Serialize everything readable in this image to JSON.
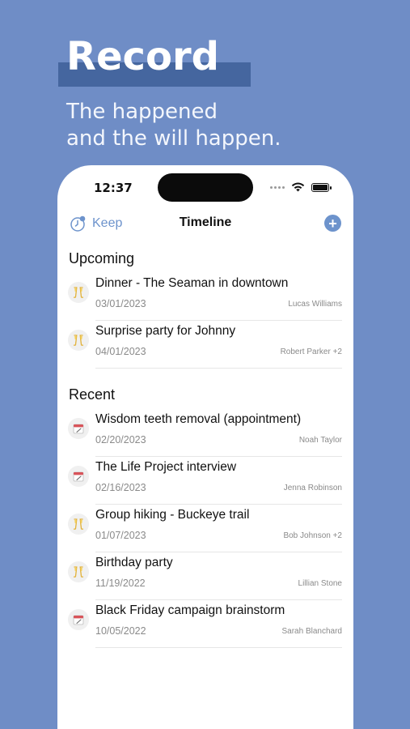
{
  "promo": {
    "headline": "Record",
    "subtitle_line1": "The happened",
    "subtitle_line2": "and the will happen."
  },
  "status_bar": {
    "time": "12:37"
  },
  "nav": {
    "keep_label": "Keep",
    "title": "Timeline",
    "add_symbol": "+"
  },
  "sections": [
    {
      "title": "Upcoming",
      "items": [
        {
          "title": "Dinner - The Seaman in downtown",
          "date": "03/01/2023",
          "people": "Lucas Williams",
          "icon": "champagne-icon"
        },
        {
          "title": "Surprise party for Johnny",
          "date": "04/01/2023",
          "people": "Robert Parker +2",
          "icon": "champagne-icon"
        }
      ]
    },
    {
      "title": "Recent",
      "items": [
        {
          "title": "Wisdom teeth removal (appointment)",
          "date": "02/20/2023",
          "people": "Noah Taylor",
          "icon": "calendar-icon"
        },
        {
          "title": "The Life Project interview",
          "date": "02/16/2023",
          "people": "Jenna Robinson",
          "icon": "calendar-icon"
        },
        {
          "title": "Group hiking - Buckeye trail",
          "date": "01/07/2023",
          "people": "Bob Johnson +2",
          "icon": "champagne-icon"
        },
        {
          "title": "Birthday party",
          "date": "11/19/2022",
          "people": "Lillian Stone",
          "icon": "champagne-icon"
        },
        {
          "title": "Black Friday campaign brainstorm",
          "date": "10/05/2022",
          "people": "Sarah Blanchard",
          "icon": "calendar-icon"
        }
      ]
    }
  ],
  "colors": {
    "background": "#6f8dc6",
    "accent": "#6d93cc",
    "headline_bar": "#45669f"
  }
}
